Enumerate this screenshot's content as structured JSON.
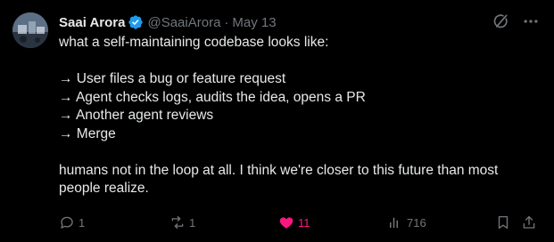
{
  "author": {
    "name": "Saai Arora",
    "handle": "@SaaiArora",
    "separator": "·",
    "date": "May 13"
  },
  "body": {
    "line1": "what a self-maintaining codebase looks like:",
    "steps": [
      "→ User files a bug or feature request",
      "→ Agent checks logs, audits the idea, opens a PR",
      "→ Another agent reviews",
      "→ Merge"
    ],
    "closing_line1": "humans not in the loop at all. I think we're closer to this future than most",
    "closing_line2": "people realize."
  },
  "actions": {
    "replies": "1",
    "reposts": "1",
    "likes": "11",
    "views": "716"
  },
  "icons": {
    "verified": "verified-badge-icon",
    "grok": "grok-icon",
    "more": "more-icon",
    "reply": "reply-icon",
    "repost": "repost-icon",
    "like": "heart-icon",
    "views": "views-icon",
    "bookmark": "bookmark-icon",
    "share": "share-icon"
  },
  "colors": {
    "background": "#000000",
    "text": "#e7e9ea",
    "muted": "#71767b",
    "verified": "#1d9bf0",
    "like": "#f91880"
  }
}
